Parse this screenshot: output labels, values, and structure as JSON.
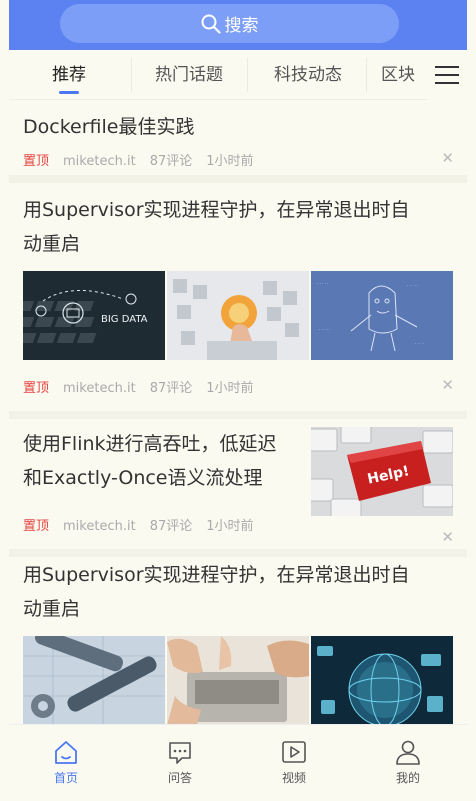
{
  "header": {
    "search_label": "搜索"
  },
  "tabs": [
    {
      "label": "推荐",
      "active": true
    },
    {
      "label": "热门话题",
      "active": false
    },
    {
      "label": "科技动态",
      "active": false
    },
    {
      "label": "区块",
      "active": false
    }
  ],
  "feed": [
    {
      "title": "Dockerfile最佳实践",
      "top_label": "置顶",
      "source": "miketech.it",
      "comments": "87评论",
      "time": "1小时前"
    },
    {
      "title_line1": "用Supervisor实现进程守护，在异常退出时自",
      "title_line2": "动重启",
      "top_label": "置顶",
      "source": "miketech.it",
      "comments": "87评论",
      "time": "1小时前",
      "thumb_text": "BIG DATA"
    },
    {
      "title_line1": "使用Flink进行高吞吐，低延迟",
      "title_line2": "和Exactly-Once语义流处理",
      "top_label": "置顶",
      "source": "miketech.it",
      "comments": "87评论",
      "time": "1小时前",
      "thumb_text": "Help!"
    },
    {
      "title_line1": "用Supervisor实现进程守护，在异常退出时自",
      "title_line2": "动重启"
    }
  ],
  "bottom_nav": [
    {
      "label": "首页",
      "icon": "home-icon",
      "active": true
    },
    {
      "label": "问答",
      "icon": "chat-icon",
      "active": false
    },
    {
      "label": "视频",
      "icon": "video-icon",
      "active": false
    },
    {
      "label": "我的",
      "icon": "user-icon",
      "active": false
    }
  ],
  "colors": {
    "accent": "#4a78f0",
    "header": "#5b82f0",
    "top_badge": "#e64340"
  }
}
